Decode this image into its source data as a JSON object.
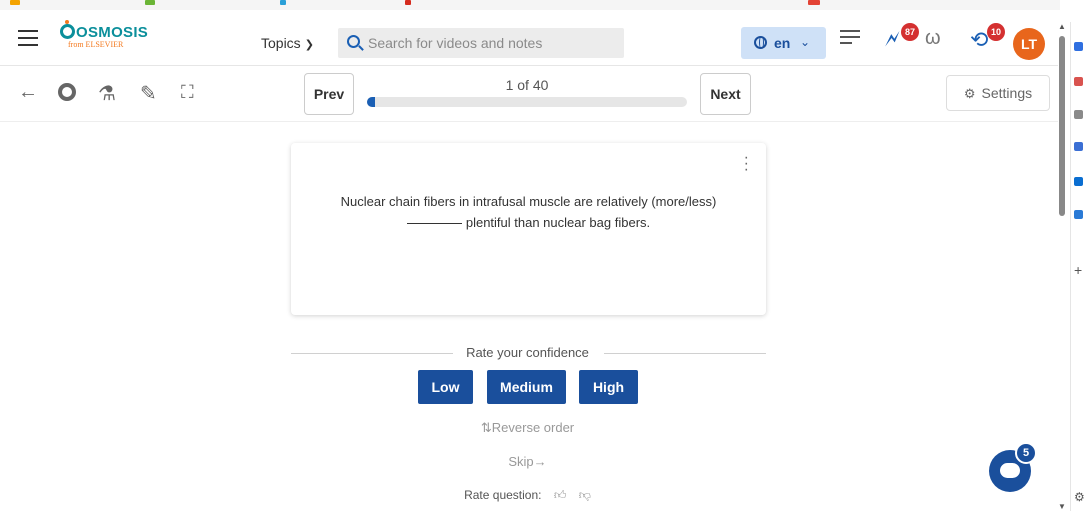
{
  "nav": {
    "logo_text": "OSMOSIS",
    "logo_sub": "from ELSEVIER",
    "topics_label": "Topics",
    "search_placeholder": "Search for videos and notes",
    "lang_label": "en",
    "bolt_badge": "87",
    "history_badge": "10",
    "avatar_initials": "LT"
  },
  "toolbar": {
    "prev_label": "Prev",
    "next_label": "Next",
    "progress_text": "1 of 40",
    "progress_fraction": 0.025,
    "settings_label": "Settings"
  },
  "card": {
    "question_part1": "Nuclear chain fibers in intrafusal muscle are relatively (more/less)",
    "question_part2": "plentiful than nuclear bag fibers."
  },
  "confidence": {
    "title": "Rate your confidence",
    "low": "Low",
    "medium": "Medium",
    "high": "High"
  },
  "footer": {
    "reverse_label": "Reverse order",
    "skip_label": "Skip",
    "rate_question_label": "Rate question:"
  },
  "chat": {
    "badge": "5"
  },
  "colors": {
    "accent": "#1a4f9c",
    "brand": "#0b8f9b",
    "avatar": "#e8661c",
    "badge": "#d43030"
  }
}
